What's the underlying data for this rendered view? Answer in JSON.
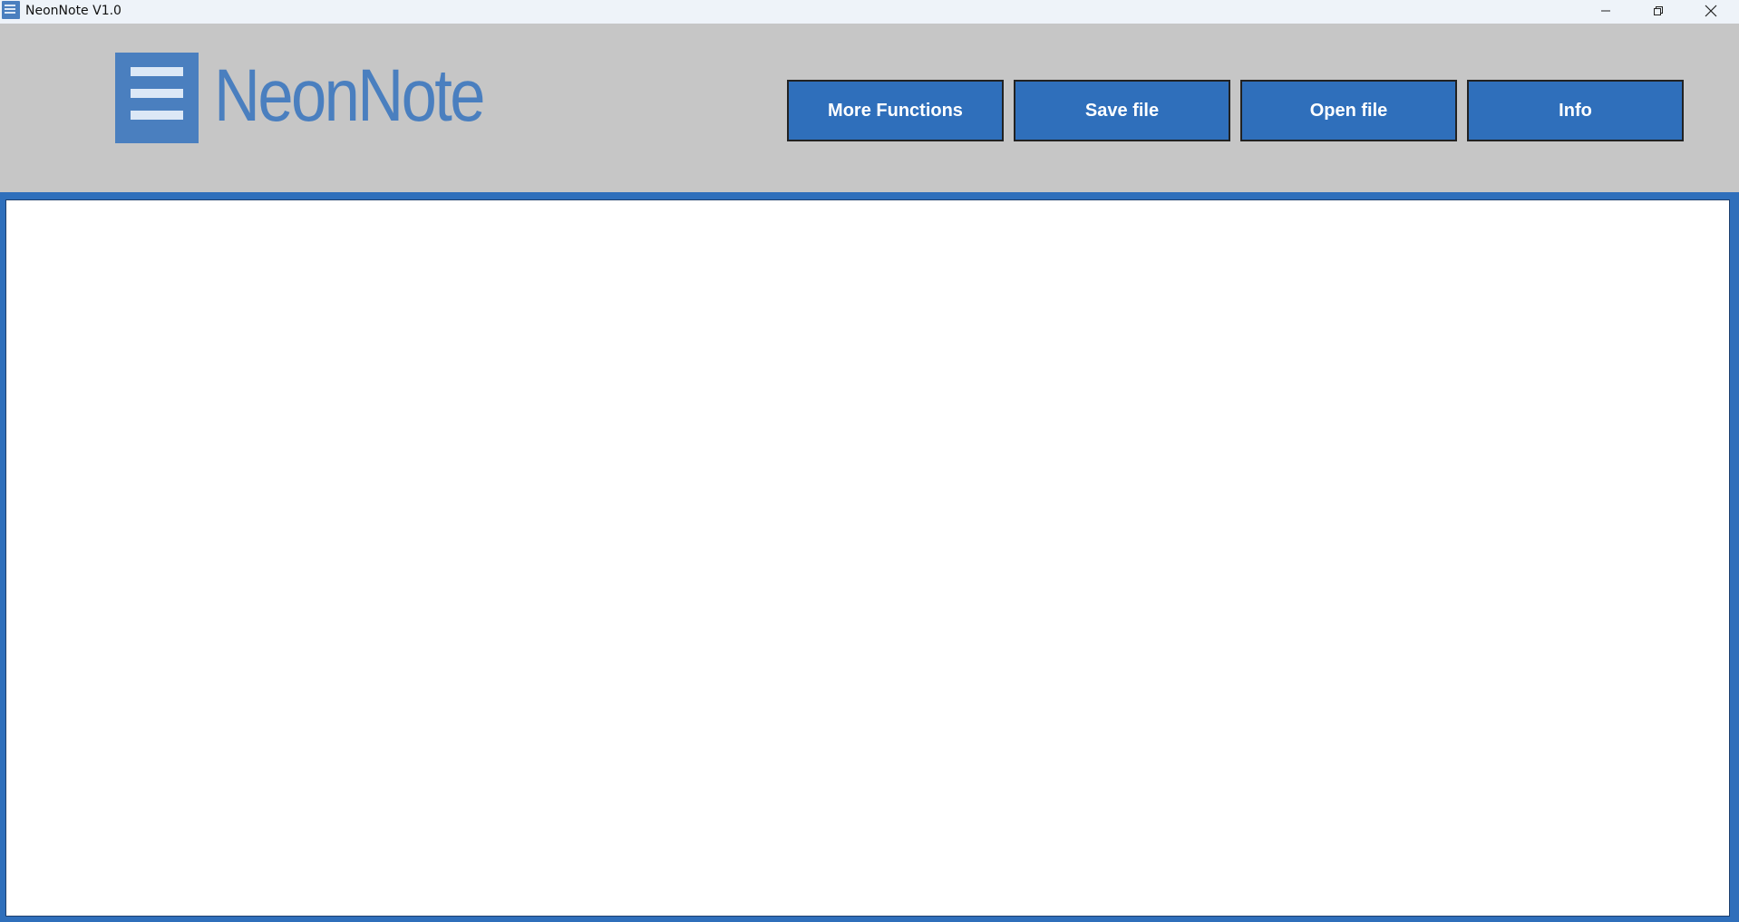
{
  "window": {
    "title": "NeonNote V1.0",
    "icon": "notepad-icon",
    "controls": {
      "minimize": "minimize-icon",
      "restore": "restore-icon",
      "close": "close-icon"
    }
  },
  "header": {
    "logo_icon": "menu-lines-icon",
    "logo_text": "NeonNote",
    "buttons": [
      {
        "label": "More Functions"
      },
      {
        "label": "Save file"
      },
      {
        "label": "Open file"
      },
      {
        "label": "Info"
      }
    ]
  },
  "editor": {
    "value": ""
  },
  "colors": {
    "accent": "#2f6fbb",
    "logo": "#4a7fbf",
    "header_bg": "#c6c6c6",
    "titlebar_bg": "#eef3f9"
  }
}
